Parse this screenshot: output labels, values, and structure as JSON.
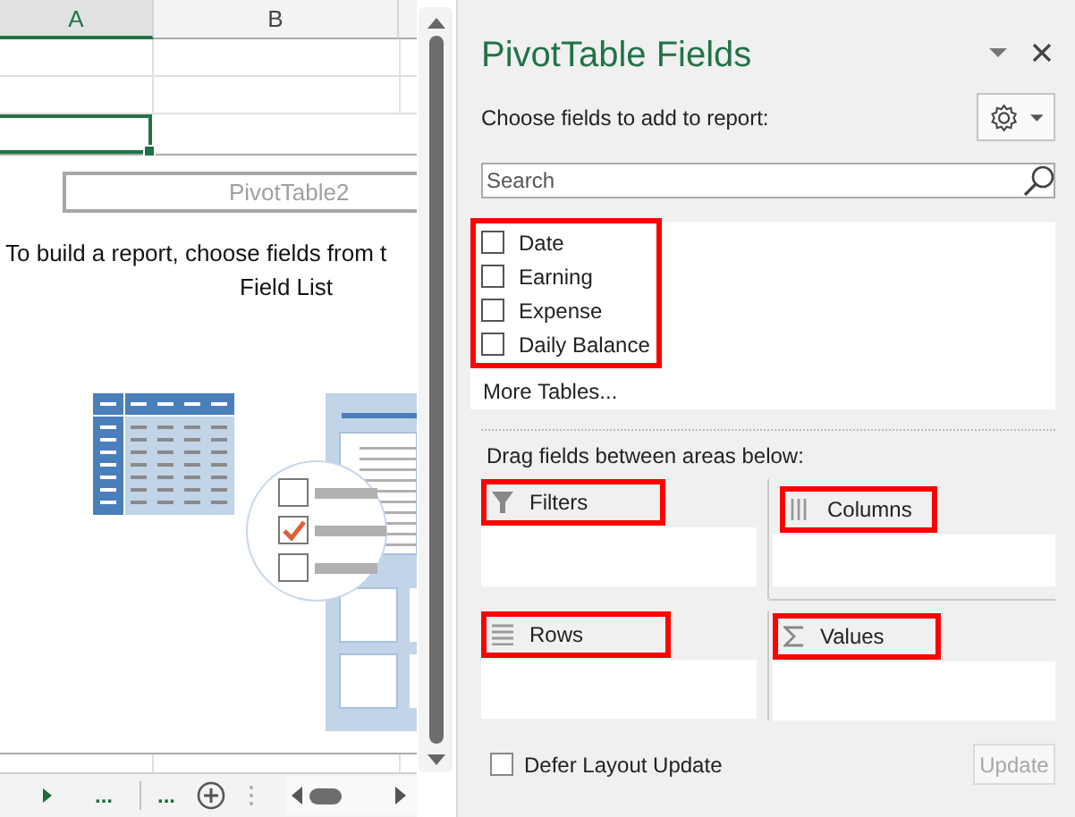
{
  "sheet": {
    "columns": [
      {
        "label": "A",
        "selected": true
      },
      {
        "label": "B",
        "selected": false
      }
    ],
    "pivot_name": "PivotTable2",
    "instruction_lines": [
      "To build a report, choose fields from t",
      "Field List"
    ],
    "tab_bar": {
      "more_left": "...",
      "more_right": "..."
    }
  },
  "panel": {
    "title": "PivotTable Fields",
    "subtitle": "Choose fields to add to report:",
    "search": {
      "placeholder": "Search"
    },
    "fields_highlighted": true,
    "fields": [
      {
        "label": "Date",
        "checked": false
      },
      {
        "label": "Earning",
        "checked": false
      },
      {
        "label": "Expense",
        "checked": false
      },
      {
        "label": "Daily Balance",
        "checked": false
      }
    ],
    "more_tables": "More Tables...",
    "areas_caption": "Drag fields between areas below:",
    "areas": [
      {
        "kind": "filters",
        "label": "Filters",
        "highlighted": true
      },
      {
        "kind": "columns",
        "label": "Columns",
        "highlighted": true
      },
      {
        "kind": "rows",
        "label": "Rows",
        "highlighted": true
      },
      {
        "kind": "values",
        "label": "Values",
        "highlighted": true
      }
    ],
    "defer": {
      "label": "Defer Layout Update",
      "checked": false
    },
    "update_button": {
      "label": "Update",
      "disabled": true
    }
  }
}
